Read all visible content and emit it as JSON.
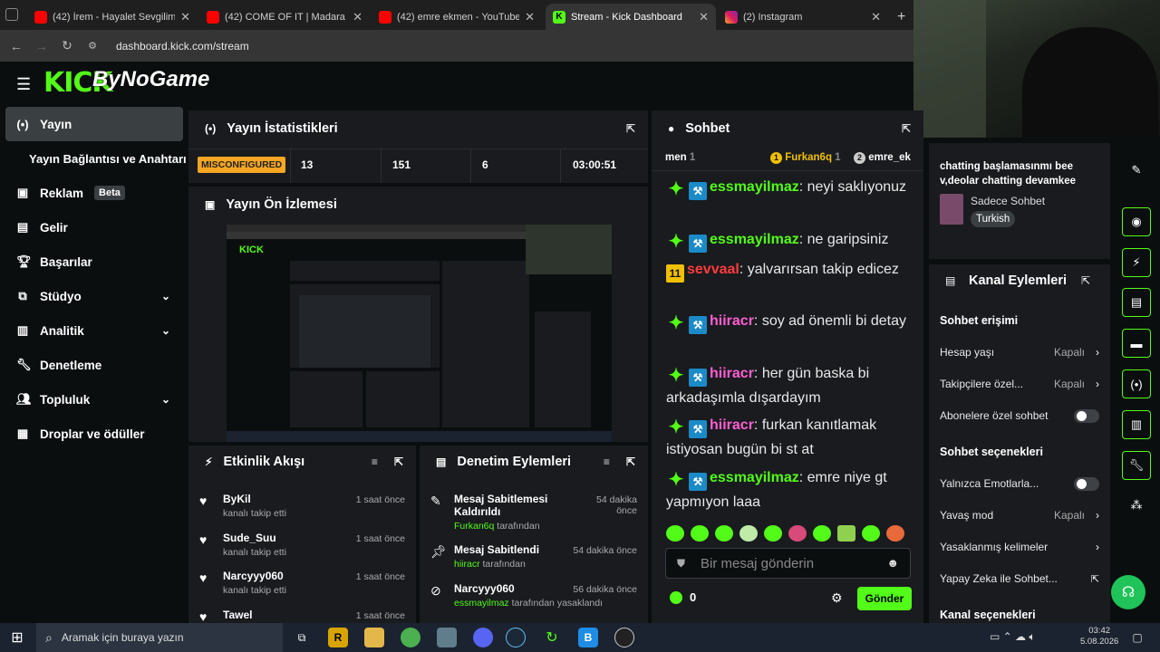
{
  "browser": {
    "tabs": [
      {
        "label": "(42) İrem - Hayalet Sevgilim (Of",
        "active": false
      },
      {
        "label": "(42) COME OF IT | Madara Oldu",
        "active": false
      },
      {
        "label": "(42) emre ekmen - YouTube",
        "active": false
      },
      {
        "label": "Stream - Kick Dashboard",
        "active": true
      },
      {
        "label": "(2) Instagram",
        "active": false
      }
    ],
    "url": "dashboard.kick.com/stream",
    "new_tab_icon": "+"
  },
  "header": {
    "logo_text": "KICK",
    "overlay_text": "ByNoGame"
  },
  "sidebar": {
    "items": [
      {
        "label": "Yayın",
        "icon": "broadcast-icon",
        "selected": true
      },
      {
        "label": "Yayın Bağlantısı ve Anahtarı",
        "icon": "",
        "selected": false
      },
      {
        "label": "Reklam",
        "icon": "ad-icon",
        "badge": "Beta"
      },
      {
        "label": "Gelir",
        "icon": "revenue-icon"
      },
      {
        "label": "Başarılar",
        "icon": "trophy-icon"
      },
      {
        "label": "Stüdyo",
        "icon": "studio-icon",
        "expandable": true
      },
      {
        "label": "Analitik",
        "icon": "analytics-icon",
        "expandable": true
      },
      {
        "label": "Denetleme",
        "icon": "wrench-icon"
      },
      {
        "label": "Topluluk",
        "icon": "community-icon",
        "expandable": true
      },
      {
        "label": "Droplar ve ödüller",
        "icon": "drops-icon"
      }
    ]
  },
  "stats": {
    "title": "Yayın İstatistikleri",
    "status": "MISCONFIGURED",
    "values": [
      "13",
      "151",
      "6",
      "03:00:51"
    ]
  },
  "preview": {
    "title": "Yayın Ön İzlemesi"
  },
  "activity": {
    "title": "Etkinlik Akışı",
    "events": [
      {
        "name": "ByKil",
        "sub": "kanalı takip etti",
        "time": "1 saat önce"
      },
      {
        "name": "Sude_Suu",
        "sub": "kanalı takip etti",
        "time": "1 saat önce"
      },
      {
        "name": "Narcyyy060",
        "sub": "kanalı takip etti",
        "time": "1 saat önce"
      },
      {
        "name": "Tawel",
        "sub": "",
        "time": "1 saat önce"
      }
    ]
  },
  "moderation": {
    "title": "Denetim Eylemleri",
    "events": [
      {
        "title": "Mesaj Sabitlemesi Kaldırıldı",
        "user": "Furkan6q",
        "suffix": "tarafından",
        "time": "54 dakika önce"
      },
      {
        "title": "Mesaj Sabitlendi",
        "user": "hiiracr",
        "suffix": "tarafından",
        "time": "54 dakika önce"
      },
      {
        "title": "Narcyyy060",
        "user": "essmayilmaz",
        "suffix": "tarafından yasaklandı",
        "time": "56 dakika önce"
      }
    ]
  },
  "chat": {
    "title": "Sohbet",
    "top_row": {
      "left": "men",
      "left_count": "1",
      "mid_rank": "1",
      "mid_user": "Furkan6q",
      "mid_count": "1",
      "right_rank": "2",
      "right_user": "emre_ek"
    },
    "messages": [
      {
        "user": "essmayilmaz",
        "color": "#53fc18",
        "text": "neyi saklıyonuz",
        "badges": [
          "vip",
          "mod"
        ]
      },
      {
        "user": "essmayilmaz",
        "color": "#53fc18",
        "text": "ne garipsiniz",
        "badges": [
          "vip",
          "mod"
        ]
      },
      {
        "user": "sevvaal",
        "color": "#ff3b3b",
        "text": "yalvarırsan takip edicez",
        "badges": [
          "sub"
        ],
        "sub_months": "11"
      },
      {
        "user": "hiiracr",
        "color": "#ff5fd2",
        "text": "soy ad önemli bi detay",
        "badges": [
          "vip",
          "mod"
        ]
      },
      {
        "user": "hiiracr",
        "color": "#ff5fd2",
        "text": "her gün baska bi arkadaşımla dışardayım",
        "badges": [
          "vip",
          "mod"
        ]
      },
      {
        "user": "hiiracr",
        "color": "#ff5fd2",
        "text": "furkan kanıtlamak istiyosan bugün bi st at",
        "badges": [
          "vip",
          "mod"
        ]
      },
      {
        "user": "essmayilmaz",
        "color": "#53fc18",
        "text": "emre niye gt yapmıyon laaa",
        "badges": [
          "vip",
          "mod"
        ]
      }
    ],
    "input_placeholder": "Bir mesaj gönderin",
    "points": "0",
    "send_label": "Gönder"
  },
  "stream_info": {
    "title": "chatting başlamasınmı bee v,deolar chatting devamkee",
    "category": "Sadece Sohbet",
    "tag": "Turkish"
  },
  "channel_actions": {
    "title": "Kanal Eylemleri",
    "section1": "Sohbet erişimi",
    "rows1": [
      {
        "label": "Hesap yaşı",
        "value": "Kapalı",
        "type": "link"
      },
      {
        "label": "Takipçilere özel...",
        "value": "Kapalı",
        "type": "link"
      },
      {
        "label": "Abonelere özel sohbet",
        "value": "",
        "type": "toggle"
      }
    ],
    "section2": "Sohbet seçenekleri",
    "rows2": [
      {
        "label": "Yalnızca Emotlarla...",
        "value": "",
        "type": "toggle"
      },
      {
        "label": "Yavaş mod",
        "value": "Kapalı",
        "type": "link"
      },
      {
        "label": "Yasaklanmış kelimeler",
        "value": "",
        "type": "link"
      },
      {
        "label": "Yapay Zeka ile Sohbet...",
        "value": "",
        "type": "external"
      }
    ],
    "section3": "Kanal seçenekleri"
  },
  "taskbar": {
    "search_placeholder": "Aramak için buraya yazın",
    "time": "03:42",
    "date": "5.08.2026"
  },
  "colors": {
    "kick_green": "#53fc18",
    "panel": "#191b1f",
    "bg": "#0b0e0f",
    "warning": "#f5a623"
  }
}
